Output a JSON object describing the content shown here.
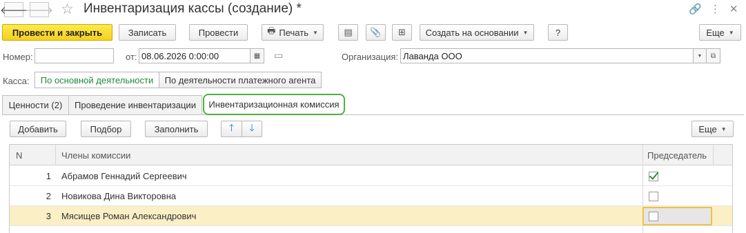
{
  "window": {
    "title": "Инвентаризация кассы (создание) *"
  },
  "toolbar": {
    "post_close": "Провести и закрыть",
    "save": "Записать",
    "post": "Провести",
    "print": "Печать",
    "create_based": "Создать на основании",
    "help": "?",
    "more": "Еще"
  },
  "header": {
    "number_label": "Номер:",
    "number_value": "",
    "date_label": "от:",
    "date_value": "08.06.2026  0:00:00",
    "org_label": "Организация:",
    "org_value": "Лаванда ООО",
    "cash_label": "Касса:",
    "cash_option_main": "По основной деятельности",
    "cash_option_agent": "По деятельности платежного агента"
  },
  "tabs": [
    {
      "label": "Ценности (2)"
    },
    {
      "label": "Проведение инвентаризации"
    },
    {
      "label": "Инвентаризационная комиссия"
    }
  ],
  "table_toolbar": {
    "add": "Добавить",
    "select": "Подбор",
    "fill": "Заполнить",
    "more": "Еще"
  },
  "table": {
    "columns": [
      "N",
      "Члены комиссии",
      "Председатель"
    ],
    "rows": [
      {
        "n": "1",
        "member": "Абрамов Геннадий Сергеевич",
        "chairman": true
      },
      {
        "n": "2",
        "member": "Новикова Дина Викторовна",
        "chairman": false
      },
      {
        "n": "3",
        "member": "Мясищев Роман Александрович",
        "chairman": false
      }
    ]
  },
  "colors": {
    "primary_button": "#f5d21c",
    "active_tab_border": "#4db13c",
    "selected_row": "#fbefc6",
    "toggle_selected_text": "#1e8a3a"
  }
}
